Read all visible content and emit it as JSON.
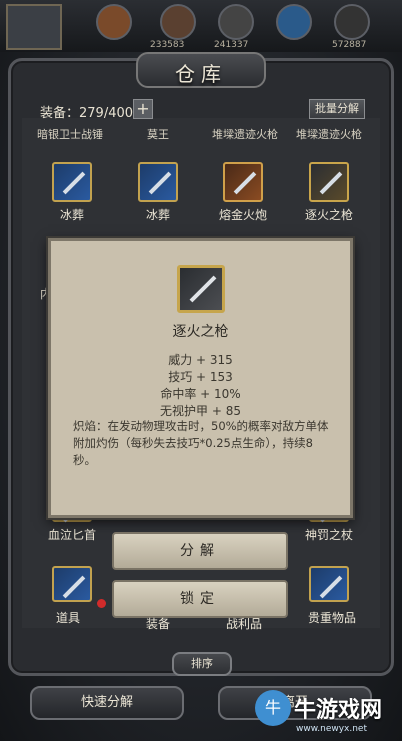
{
  "header": {
    "title": "仓库",
    "top_numbers": [
      "233583",
      "241337",
      "572887"
    ]
  },
  "toolbar": {
    "equip_count": "装备：279/400",
    "add_icon": "+",
    "batch_dismantle": "批量分解"
  },
  "partial_row": [
    "暗银卫士战锤",
    "莫王",
    "堆墚遗迹火枪",
    "堆墚遗迹火枪"
  ],
  "items": [
    {
      "name": "冰葬",
      "style": "blue"
    },
    {
      "name": "冰葬",
      "style": "blue"
    },
    {
      "name": "熔金火炮",
      "style": "red"
    },
    {
      "name": "逐火之枪",
      "style": "dark"
    }
  ],
  "lower_items": [
    {
      "name": "血泣匕首"
    },
    {
      "name": "神罚之杖"
    }
  ],
  "side_partial": "内",
  "popup": {
    "name": "逐火之枪",
    "stats": [
      "威力 + 315",
      "技巧 + 153",
      "命中率 + 10%",
      "无视护甲 + 85"
    ],
    "description": "炽焰：在发动物理攻击时，50%的概率对敌方单体附加灼伤（每秒失去技巧*0.25点生命），持续8秒。"
  },
  "actions": {
    "dismantle": "分解",
    "lock": "锁定"
  },
  "tabs": [
    "道具",
    "装备",
    "战利品",
    "贵重物品"
  ],
  "sort_label": "排序",
  "bottom": {
    "quick_dismantle": "快速分解",
    "leave": "离开"
  },
  "watermark": {
    "text": "牛游戏网",
    "url": "www.newyx.net"
  }
}
